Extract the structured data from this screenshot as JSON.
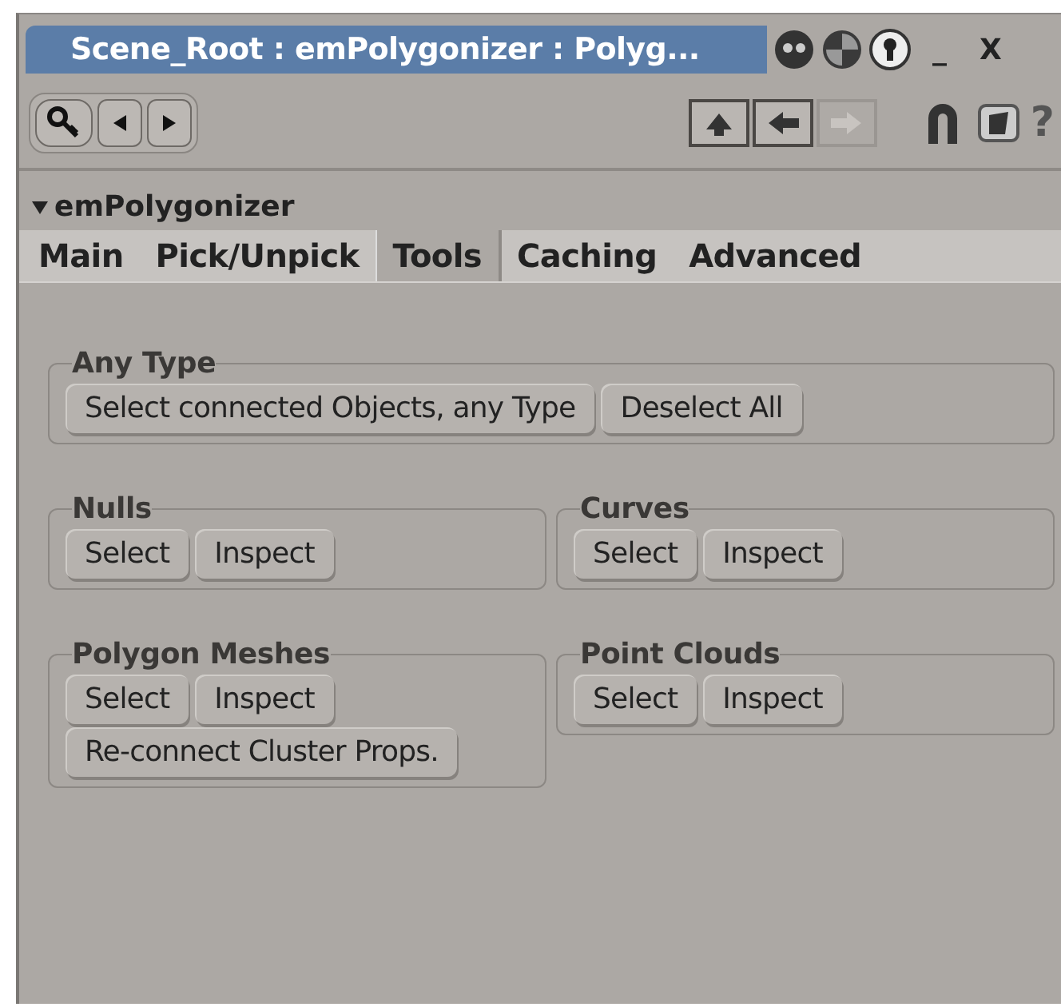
{
  "window": {
    "title": "Scene_Root : emPolygonizer : Polyg...",
    "controls": [
      "_",
      "X"
    ]
  },
  "toolbar": {
    "nav": [
      {
        "kind": "up",
        "disabled": false
      },
      {
        "kind": "left",
        "disabled": false
      },
      {
        "kind": "right",
        "disabled": true
      }
    ],
    "help": "?"
  },
  "property": {
    "name": "emPolygonizer",
    "expanded": true
  },
  "tabs": [
    {
      "label": "Main",
      "selected": false
    },
    {
      "label": "Pick/Unpick",
      "selected": false
    },
    {
      "label": "Tools",
      "selected": true
    },
    {
      "label": "Caching",
      "selected": false
    },
    {
      "label": "Advanced",
      "selected": false
    }
  ],
  "groups": [
    {
      "title": "Any Type",
      "wide": true,
      "rows": [
        [
          "Select connected Objects, any Type",
          "Deselect All"
        ]
      ]
    },
    {
      "title": "Nulls",
      "wide": false,
      "rows": [
        [
          "Select",
          "Inspect"
        ]
      ]
    },
    {
      "title": "Curves",
      "wide": false,
      "rows": [
        [
          "Select",
          "Inspect"
        ]
      ]
    },
    {
      "title": "Polygon Meshes",
      "wide": false,
      "rows": [
        [
          "Select",
          "Inspect"
        ],
        [
          "Re-connect Cluster Props."
        ]
      ]
    },
    {
      "title": "Point Clouds",
      "wide": false,
      "rows": [
        [
          "Select",
          "Inspect"
        ]
      ]
    }
  ]
}
